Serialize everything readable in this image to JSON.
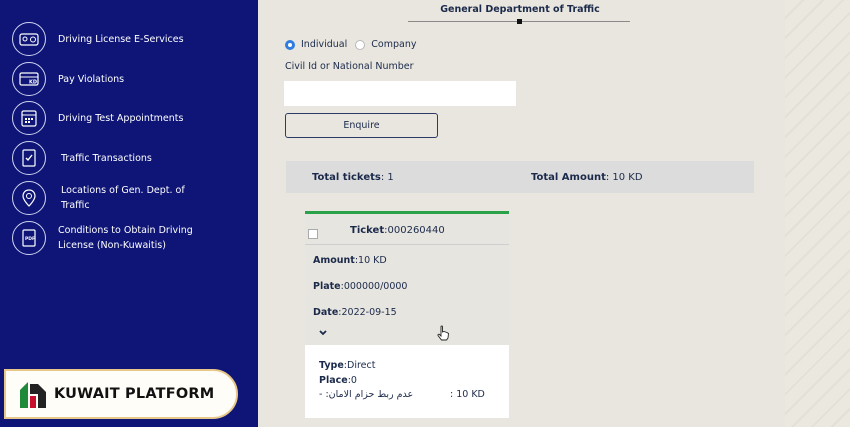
{
  "header": {
    "department_title": "General Department of Traffic"
  },
  "sidebar": {
    "items": [
      {
        "label": "Driving License E-Services",
        "icon": "license-card-icon"
      },
      {
        "label": "Pay Violations",
        "icon": "payment-kd-icon"
      },
      {
        "label": "Driving Test Appointments",
        "icon": "calendar-icon"
      },
      {
        "label": "Traffic Transactions",
        "icon": "document-check-icon"
      },
      {
        "label": "Locations of Gen. Dept. of Traffic",
        "icon": "location-pin-icon"
      },
      {
        "label": "Conditions to Obtain Driving License (Non-Kuwaitis)",
        "icon": "pdf-document-icon"
      }
    ]
  },
  "form": {
    "radio_individual": "Individual",
    "radio_company": "Company",
    "selected": "Individual",
    "civil_id_label": "Civil Id or National Number",
    "civil_id_value": "",
    "enquire_label": "Enquire"
  },
  "summary": {
    "total_tickets_label": "Total tickets",
    "total_tickets_value": ": 1",
    "total_amount_label": "Total Amount",
    "total_amount_value": ": 10 KD"
  },
  "ticket": {
    "ticket_label": "Ticket",
    "ticket_value": ":000260440",
    "amount_label": "Amount",
    "amount_value": ":10 KD",
    "plate_label": "Plate",
    "plate_value": ":000000/0000",
    "date_label": "Date",
    "date_value": ":2022-09-15",
    "type_label": "Type",
    "type_value": ":Direct",
    "place_label": "Place",
    "place_value": ":0",
    "violation_text": "- :عدم ربط حزام الامان",
    "violation_amount": ":  10 KD",
    "accent_color": "#2aa24a"
  },
  "badge": {
    "text": "KUWAIT PLATFORM"
  },
  "colors": {
    "sidebar_bg": "#0e1577",
    "radio_selected": "#2f7de1",
    "content_bg": "#e9e6df"
  }
}
